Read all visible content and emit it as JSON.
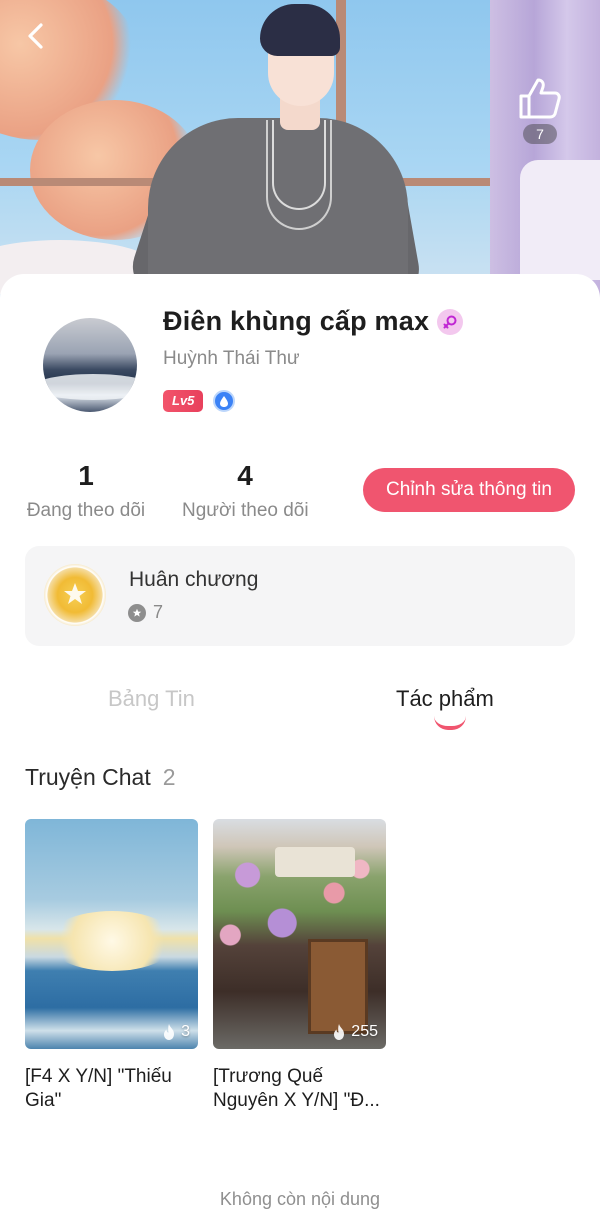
{
  "header": {
    "like_count": "7"
  },
  "profile": {
    "display_name": "Điên khùng cấp max",
    "real_name": "Huỳnh Thái Thư",
    "level": "Lv5",
    "following_count": "1",
    "following_label": "Đang theo dõi",
    "followers_count": "4",
    "followers_label": "Người theo dõi",
    "edit_button_label": "Chỉnh sửa thông tin"
  },
  "medals": {
    "title": "Huân chương",
    "count": "7"
  },
  "tabs": [
    {
      "label": "Bảng Tin",
      "active": false
    },
    {
      "label": "Tác phẩm",
      "active": true
    }
  ],
  "stories_section": {
    "title": "Truyện Chat",
    "count": "2",
    "items": [
      {
        "title": "[F4 X Y/N] \"Thiếu Gia\"",
        "fire_count": "3"
      },
      {
        "title": "[Trương Quế Nguyên X Y/N] \"Đ...",
        "fire_count": "255"
      }
    ]
  },
  "end_message": "Không còn nội dung",
  "colors": {
    "accent": "#f0556f",
    "level_badge": "#e8405c",
    "muted_text": "#8a8a8a"
  },
  "icons": {
    "back": "chevron-left-icon",
    "like": "thumbs-up-icon",
    "gender": "female-symbol-icon",
    "water_badge": "water-drop-icon",
    "medal": "medal-icon",
    "medal_count": "star-icon",
    "fire": "fire-icon"
  }
}
